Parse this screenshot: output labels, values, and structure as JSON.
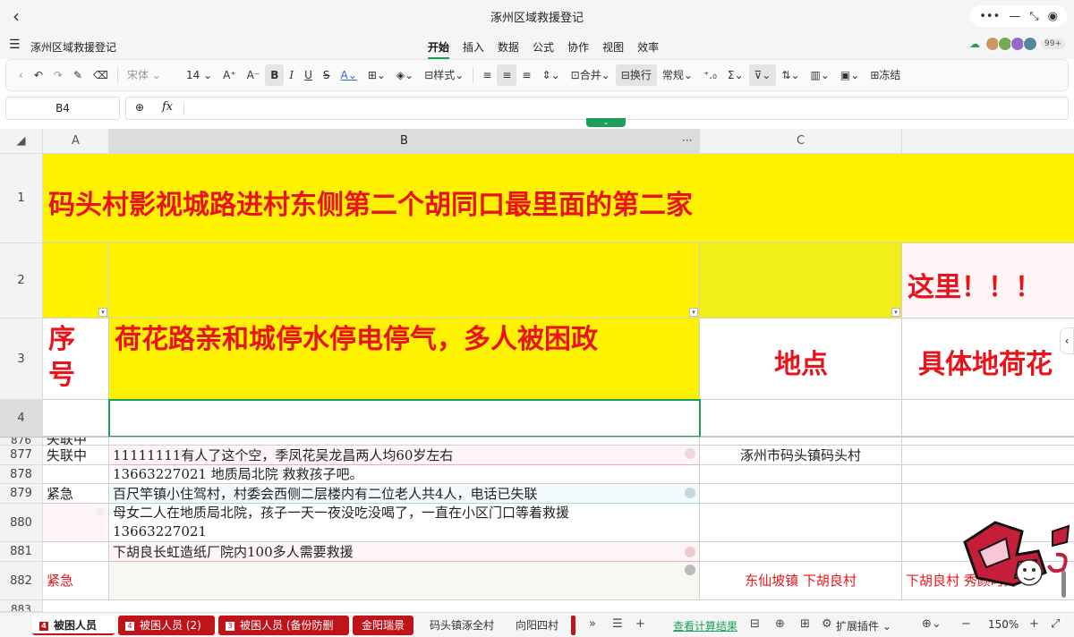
{
  "window": {
    "title": "涿州区域救援登记"
  },
  "menu": {
    "doc_name": "涿州区域救援登记",
    "tabs": [
      "开始",
      "插入",
      "数据",
      "公式",
      "协作",
      "视图",
      "效率"
    ],
    "active_tab": "开始",
    "collab_more": "99+"
  },
  "toolbar": {
    "font_name": "宋体",
    "font_size": "14",
    "style_label": "样式",
    "merge_label": "合并",
    "wrap_label": "换行",
    "format_label": "常规",
    "freeze_label": "冻结"
  },
  "formula": {
    "cell_ref": "B4",
    "fx": "fx",
    "value": ""
  },
  "columns": [
    "A",
    "B",
    "C"
  ],
  "rows": {
    "r1": {
      "num": "1",
      "text": "码头村影视城路进村东侧第二个胡同口最里面的第二家"
    },
    "r2": {
      "num": "2",
      "d": "这里！！！"
    },
    "r3": {
      "num": "3",
      "a": "序号",
      "b": "荷花路亲和城停水停电停气，多人被困政",
      "c": "地点",
      "d": "具体地荷花"
    },
    "r4": {
      "num": "4"
    },
    "r876": {
      "num": "876",
      "a": "失联中"
    },
    "r877": {
      "num": "877",
      "a": "失联中",
      "b": "11111111有人了这个空，季凤花吴龙昌两人均60岁左右",
      "c": "涿州市码头镇码头村"
    },
    "r878": {
      "num": "878",
      "b": "13663227021 地质局北院 救救孩子吧。"
    },
    "r879": {
      "num": "879",
      "a": "紧急",
      "b": "百尺竿镇小住驾村，村委会西侧二层楼内有二位老人共4人，电话已失联"
    },
    "r880": {
      "num": "880",
      "b1": "母女二人在地质局北院，孩子一天一夜没吃没喝了，一直在小区门口等着救援",
      "b2": "13663227021"
    },
    "r881": {
      "num": "881",
      "b": "下胡良长虹造纸厂院内100多人需要救援"
    },
    "r882": {
      "num": "882",
      "a": "紧急",
      "c": "东仙坡镇 下胡良村",
      "d": "下胡良村 秀颜时对"
    },
    "r883": {
      "num": "883"
    }
  },
  "sheets": {
    "tab1": {
      "num": "4",
      "label": "被困人员"
    },
    "tab2": {
      "num": "4",
      "label": "被困人员 (2)"
    },
    "tab3": {
      "num": "3",
      "label": "被困人员 (备份防删"
    },
    "tab4": {
      "label": "金阳瑞景"
    },
    "tab5": {
      "label": "码头镇涿全村"
    },
    "tab6": {
      "label": "向阳四村"
    }
  },
  "statusbar": {
    "calc_link": "查看计算结果",
    "ext": "扩展插件",
    "zoom": "150%"
  },
  "colors": {
    "yellow": "#fff200",
    "red_text": "#e8131b",
    "accent": "#1e9e5b",
    "sheet_red": "#c0141b"
  }
}
